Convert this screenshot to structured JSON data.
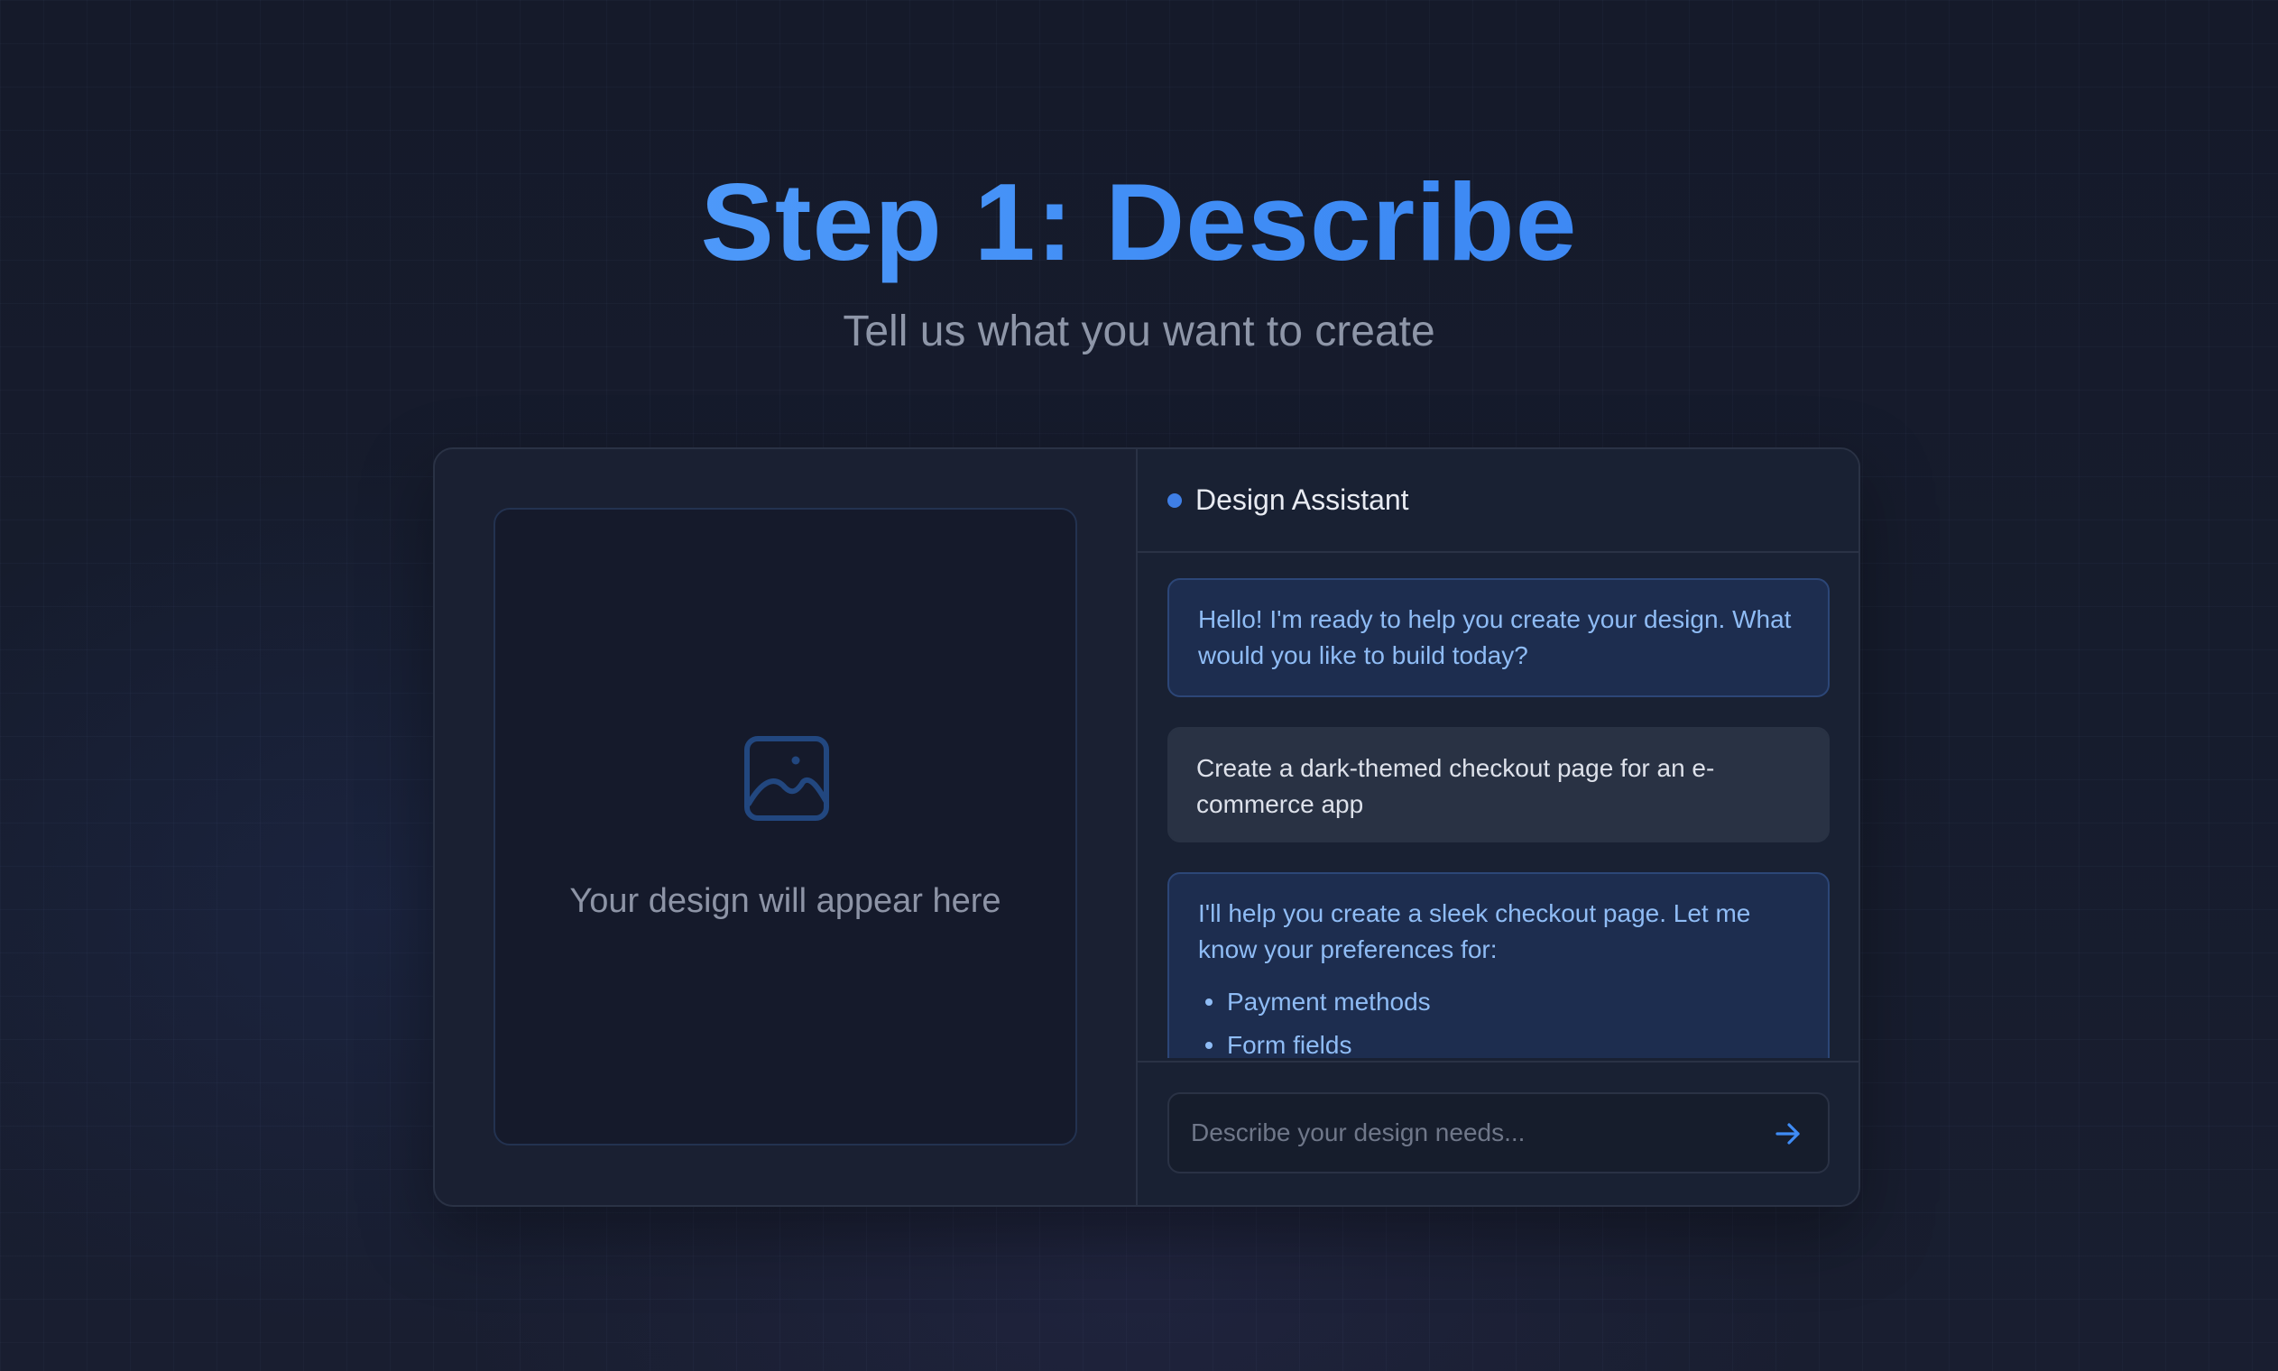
{
  "header": {
    "title": "Step 1: Describe",
    "subtitle": "Tell us what you want to create"
  },
  "preview": {
    "icon": "image-icon",
    "placeholder": "Your design will appear here"
  },
  "chat": {
    "title": "Design Assistant",
    "status_color": "#3f7fe6",
    "messages": [
      {
        "role": "assistant",
        "text": "Hello! I'm ready to help you create your design. What would you like to build today?"
      },
      {
        "role": "user",
        "text": "Create a dark-themed checkout page for an e-commerce app"
      },
      {
        "role": "assistant",
        "text": "I'll help you create a sleek checkout page. Let me know your preferences for:",
        "bullets": [
          "Payment methods",
          "Form fields"
        ]
      }
    ],
    "input": {
      "placeholder": "Describe your design needs...",
      "value": "",
      "send_icon": "arrow-right-icon"
    }
  },
  "colors": {
    "accent": "#3f8cf5",
    "background": "#161b2c",
    "card": "#1a2032"
  }
}
